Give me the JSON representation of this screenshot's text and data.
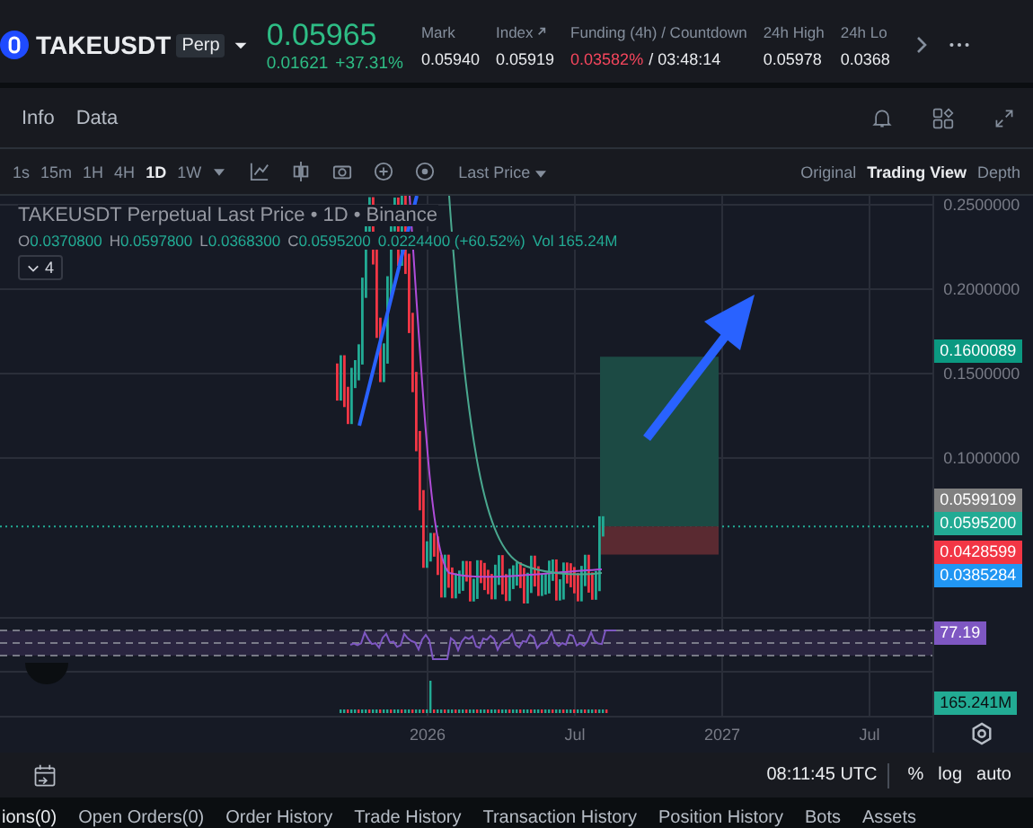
{
  "header": {
    "symbol": "TAKEUSDT",
    "badge": "Perp",
    "price": "0.05965",
    "change": "0.01621",
    "change_pct": "+37.31%",
    "stats": [
      {
        "label": "Mark",
        "value": "0.05940",
        "kind": "plain"
      },
      {
        "label": "Index",
        "value": "0.05919",
        "kind": "link"
      },
      {
        "label": "Funding (4h) / Countdown",
        "value": "0.03582%",
        "value_2": "/ 03:48:14",
        "kind": "funding"
      },
      {
        "label": "24h High",
        "value": "0.05978",
        "kind": "plain"
      },
      {
        "label": "24h Lo",
        "value": "0.0368",
        "kind": "plain"
      }
    ]
  },
  "nav": {
    "items": [
      {
        "label": "Info"
      },
      {
        "label": "Data"
      }
    ]
  },
  "toolbar": {
    "intervals": [
      {
        "label": "1s",
        "selected": false
      },
      {
        "label": "15m",
        "selected": false
      },
      {
        "label": "1H",
        "selected": false
      },
      {
        "label": "4H",
        "selected": false
      },
      {
        "label": "1D",
        "selected": true
      },
      {
        "label": "1W",
        "selected": false
      }
    ],
    "price_type": "Last Price",
    "views": [
      {
        "label": "Original",
        "selected": false
      },
      {
        "label": "Trading View",
        "selected": true
      },
      {
        "label": "Depth",
        "selected": false
      }
    ]
  },
  "chart": {
    "title": "TAKEUSDT Perpetual Last Price • 1D • Binance",
    "ohlc": [
      {
        "key": "O",
        "value": "0.0370800"
      },
      {
        "key": "H",
        "value": "0.0597800"
      },
      {
        "key": "L",
        "value": "0.0368300"
      },
      {
        "key": "C",
        "value": "0.0595200"
      }
    ],
    "change": "0.0224400 (+60.52%)",
    "volume": "Vol 165.24M",
    "indicators_count": "4",
    "price_ticks": [
      "0.2500000",
      "0.2000000",
      "0.1500000",
      "0.1000000"
    ],
    "price_tags": [
      {
        "value": "0.1600089",
        "color": "#0b9981"
      },
      {
        "value": "0.0599109",
        "color": "#808080"
      },
      {
        "value": "0.0595200",
        "color": "#22ab94"
      },
      {
        "value": "0.0428599",
        "color": "#f23645"
      },
      {
        "value": "0.0385284",
        "color": "#2196f3"
      }
    ],
    "rsi_tag": "77.19",
    "volume_tag": "165.241M",
    "time_ticks": [
      "2026",
      "Jul",
      "2027",
      "Jul"
    ]
  },
  "footer": {
    "time": "08:11:45 UTC",
    "options": [
      "%",
      "log",
      "auto"
    ]
  },
  "bottom_tabs": [
    {
      "label": "ions(0)"
    },
    {
      "label": "Open Orders(0)"
    },
    {
      "label": "Order History"
    },
    {
      "label": "Trade History"
    },
    {
      "label": "Transaction History"
    },
    {
      "label": "Position History"
    },
    {
      "label": "Bots"
    },
    {
      "label": "Assets"
    }
  ]
}
